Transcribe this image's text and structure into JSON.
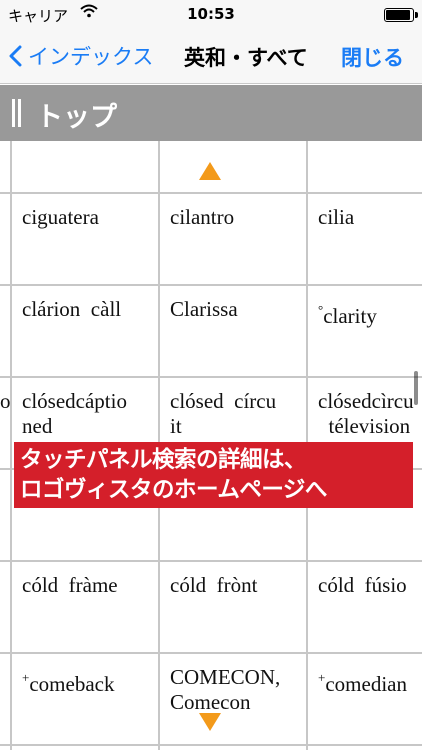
{
  "status_bar": {
    "carrier": "キャリア",
    "wifi_icon": "wifi-icon",
    "time": "10:53",
    "battery_level": 0.95
  },
  "nav": {
    "back_label": "インデックス",
    "title": "英和・すべて",
    "close_label": "閉じる"
  },
  "section": {
    "label": "トップ"
  },
  "grid": {
    "rows": [
      {
        "c0": "",
        "c1": "",
        "c2": "",
        "c3": ""
      },
      {
        "c0": "",
        "c1": "ciguatera",
        "c2": "cilantro",
        "c3": "cilia"
      },
      {
        "c0": "",
        "c1": "clárion  càll",
        "c2": "Clarissa",
        "c3": "clarity"
      },
      {
        "c0": "o",
        "c1": "clósedcáptio\nned",
        "c2": "clósed  círcu\nit",
        "c3": "clósedcìrcu\n  télevision"
      },
      {
        "c0": "",
        "c1": "",
        "c2": "",
        "c3": ""
      },
      {
        "c0": "",
        "c1": "",
        "c2": "",
        "c3": ""
      },
      {
        "c0": "",
        "c1": "cóld  fràme",
        "c2": "cóld  frònt",
        "c3": "cóld  fúsio"
      },
      {
        "c0": "",
        "c1": "comeback",
        "c2": "COMECON,\nComecon",
        "c3": "comedian"
      }
    ],
    "marks": {
      "clarity": "°",
      "comeback": "+",
      "comedian": "+"
    }
  },
  "banner": {
    "line1": "タッチパネル検索の詳細は、",
    "line2": "ロゴヴィスタのホームページへ"
  },
  "colors": {
    "accent": "#1a7cf5",
    "header_bg": "#999999",
    "arrow": "#f39a1a",
    "banner_bg": "#d41f2a"
  }
}
